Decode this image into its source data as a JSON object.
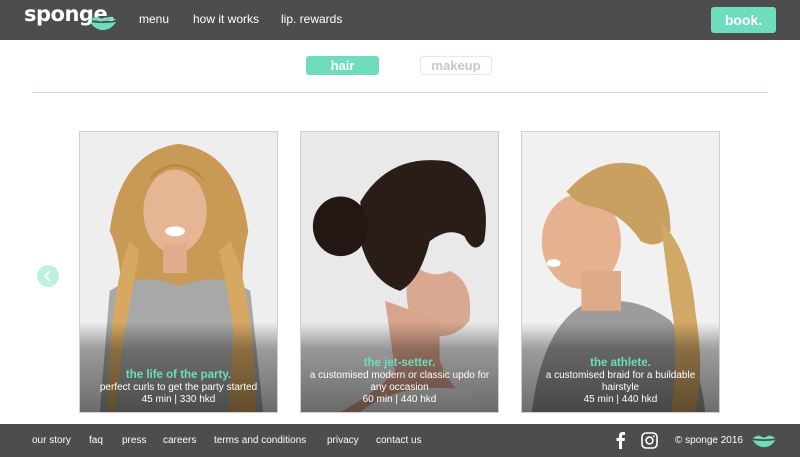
{
  "header": {
    "logo_text": "sponge.",
    "nav": [
      "menu",
      "how it works",
      "lip. rewards"
    ],
    "book_label": "book."
  },
  "tabs": [
    {
      "label": "hair",
      "active": true
    },
    {
      "label": "makeup",
      "active": false
    }
  ],
  "carousel": {
    "cards": [
      {
        "title": "the life of the party.",
        "description": "perfect curls to get the party started",
        "meta": "45 min | 330 hkd"
      },
      {
        "title": "the jet-setter.",
        "description": "a customised modern or classic updo for any occasion",
        "meta": "60 min | 440 hkd"
      },
      {
        "title": "the athlete.",
        "description": "a customised braid for a buildable hairstyle",
        "meta": "45 min | 440 hkd"
      }
    ]
  },
  "footer": {
    "links": [
      "our story",
      "faq",
      "press",
      "careers",
      "terms and conditions",
      "privacy",
      "contact us"
    ],
    "copyright": "© sponge 2016"
  },
  "colors": {
    "accent": "#6fdcbd",
    "bar": "#4d4d4d"
  },
  "icons": [
    "lips-icon",
    "chevron-left-icon",
    "facebook-icon",
    "instagram-icon"
  ]
}
